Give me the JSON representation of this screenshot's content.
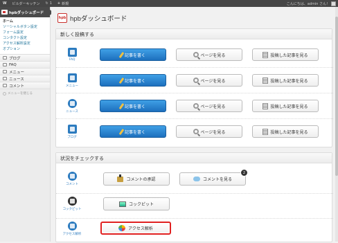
{
  "adminbar": {
    "wp_logo": "W",
    "site_name": "ビルダーキッチン",
    "update_icon": "↻",
    "update_count": "1",
    "new_label": "新規",
    "greeting": "こんにちは、admin さん！"
  },
  "sidebar": {
    "current_menu": "hpbダッシュボード",
    "submenu": [
      "ホーム",
      "ソーシャルボタン設定",
      "フォーム設定",
      "コンタクト設定",
      "アクセス解析設定",
      "オプション"
    ],
    "items": [
      {
        "label": "ブログ",
        "icon": "blog-icon"
      },
      {
        "label": "FAQ",
        "icon": "faq-icon"
      },
      {
        "label": "メニュー",
        "icon": "menu-icon"
      },
      {
        "label": "ニュース",
        "icon": "news-icon"
      },
      {
        "label": "コメント",
        "icon": "comment-icon"
      }
    ],
    "collapse_label": "メニューを閉じる"
  },
  "page": {
    "logo_text": "hpb",
    "title": "hpbダッシュボード"
  },
  "post_panel": {
    "heading": "新しく投稿する",
    "rows": [
      {
        "label": "FAQ",
        "write": "記事を書く",
        "view": "ページを見る",
        "list": "投稿した記事を見る",
        "icon": "faq-icon"
      },
      {
        "label": "メニュー",
        "write": "記事を書く",
        "view": "ページを見る",
        "list": "投稿した記事を見る",
        "icon": "menu-icon"
      },
      {
        "label": "ニュース",
        "write": "記事を書く",
        "view": "ページを見る",
        "list": "投稿した記事を見る",
        "icon": "news-icon"
      },
      {
        "label": "ブログ",
        "write": "記事を書く",
        "view": "ページを見る",
        "list": "投稿した記事を見る",
        "icon": "blog-icon"
      }
    ]
  },
  "status_panel": {
    "heading": "状況をチェックする",
    "comment": {
      "label": "コメント",
      "approve": "コメントの承認",
      "view": "コメントを見る",
      "badge": "2"
    },
    "cockpit": {
      "label": "コックピット",
      "button": "コックピット"
    },
    "access": {
      "label": "アクセス解析",
      "button": "アクセス解析"
    }
  },
  "colors": {
    "accent": "#2c7bbf",
    "highlight": "#e02020",
    "logo": "#c9302c"
  }
}
